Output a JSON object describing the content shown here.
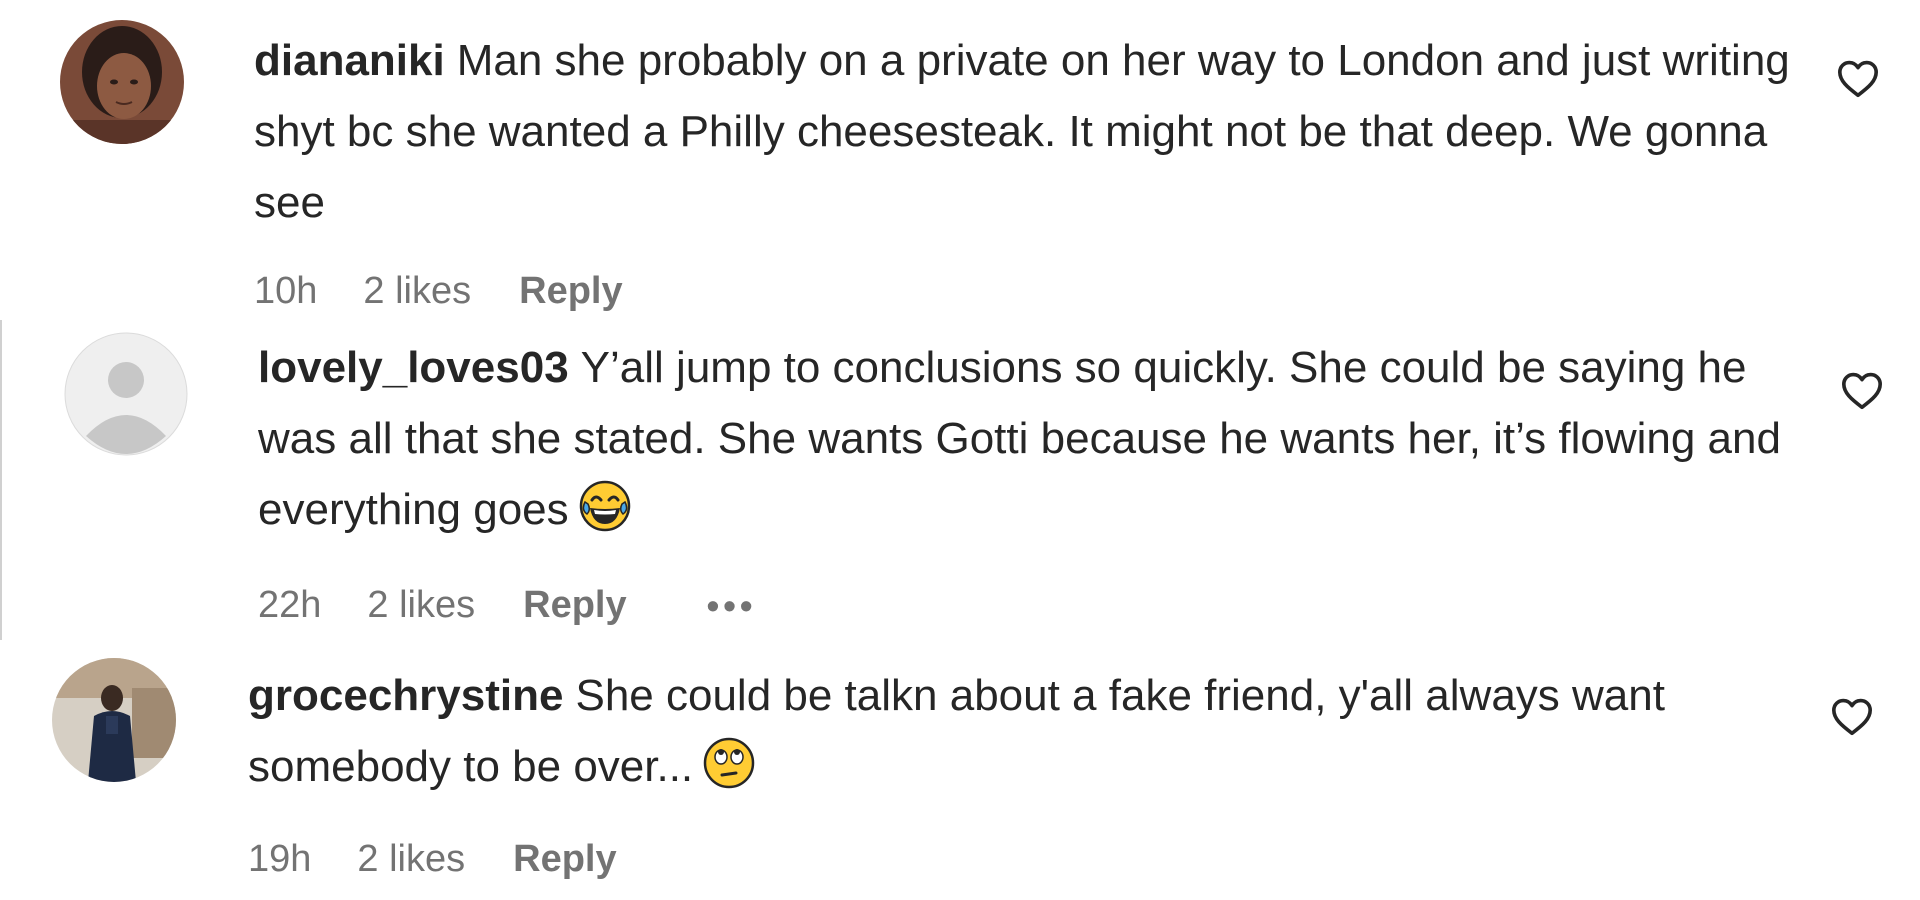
{
  "comments": [
    {
      "username": "diananiki",
      "text": "Man she probably on a private on her way to London and just writing shyt bc she wanted a Philly cheesesteak. It might not be that deep. We gonna see",
      "time": "10h",
      "likes": "2 likes",
      "reply": "Reply",
      "avatar": "profile-photo",
      "emoji": ""
    },
    {
      "username": "lovely_loves03",
      "text": "Y’all jump to conclusions so quickly. She could be saying he was all that she stated. She wants Gotti because he wants her, it’s flowing and everything goes",
      "time": "22h",
      "likes": "2 likes",
      "reply": "Reply",
      "more": "•••",
      "avatar": "default-person-icon",
      "emoji": "tears-of-joy-emoji"
    },
    {
      "username": "grocechrystine",
      "text": "She could be talkn about a fake friend, y'all always want somebody to be over...",
      "time": "19h",
      "likes": "2 likes",
      "reply": "Reply",
      "avatar": "profile-photo",
      "emoji": "eye-roll-emoji"
    }
  ],
  "icons": {
    "like": "heart-outline-icon"
  },
  "colors": {
    "text": "#262626",
    "meta": "#737373",
    "default_avatar_bg": "#efefef",
    "default_avatar_fg": "#c7c7c7"
  }
}
